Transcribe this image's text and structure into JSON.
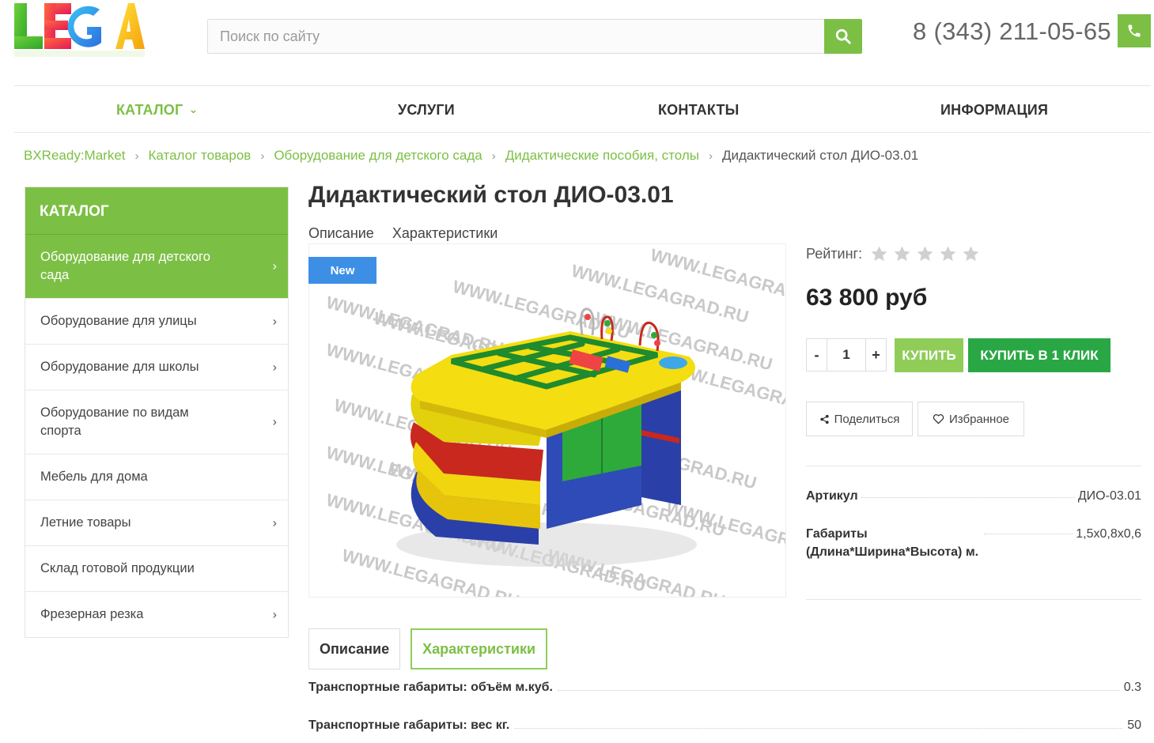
{
  "header": {
    "logo_text": "LEGA",
    "search_placeholder": "Поиск по сайту",
    "phone": "8 (343) 211-05-65"
  },
  "nav": {
    "items": [
      {
        "label": "КАТАЛОГ",
        "chevron": "⌄",
        "active": true
      },
      {
        "label": "УСЛУГИ"
      },
      {
        "label": "КОНТАКТЫ"
      },
      {
        "label": "ИНФОРМАЦИЯ"
      }
    ]
  },
  "breadcrumb": {
    "items": [
      "BXReady:Market",
      "Каталог товаров",
      "Оборудование для детского сада",
      "Дидактические пособия, столы"
    ],
    "current": "Дидактический стол ДИО-03.01",
    "separator": "›"
  },
  "sidebar": {
    "title": "КАТАЛОГ",
    "items": [
      {
        "label": "Оборудование для детского сада",
        "arrow": "›"
      },
      {
        "label": "Оборудование для улицы",
        "arrow": "›"
      },
      {
        "label": "Оборудование для школы",
        "arrow": "›"
      },
      {
        "label": "Оборудование по видам спорта",
        "arrow": "›"
      },
      {
        "label": "Мебель для дома",
        "arrow": ""
      },
      {
        "label": "Летние товары",
        "arrow": "›"
      },
      {
        "label": "Склад готовой продукции",
        "arrow": ""
      },
      {
        "label": "Фрезерная резка",
        "arrow": "›"
      }
    ]
  },
  "product": {
    "title": "Дидактический стол ДИО-03.01",
    "subtabs": [
      "Описание",
      "Характеристики"
    ],
    "badge": "New",
    "watermark": "WWW.LEGAGRAD.RU",
    "rating_label": "Рейтинг:",
    "rating_value": 0,
    "rating_max": 5,
    "price": "63 800 руб",
    "qty": {
      "minus": "-",
      "value": "1",
      "plus": "+"
    },
    "buy_label": "КУПИТЬ",
    "buy_one_click_label": "КУПИТЬ В 1 КЛИК",
    "share_label": "Поделиться",
    "favorite_label": "Избранное",
    "props": [
      {
        "name": "Артикул",
        "value": "ДИО-03.01"
      },
      {
        "name": "Габариты (Длина*Ширина*Высота) м.",
        "value": "1,5х0,8х0,6"
      }
    ]
  },
  "tabs": {
    "items": [
      "Описание",
      "Характеристики"
    ],
    "selected": 1
  },
  "specs": [
    {
      "name": "Транспортные габариты: объём м.куб.",
      "value": "0.3"
    },
    {
      "name": "Транспортные габариты: вес кг.",
      "value": "50"
    }
  ],
  "colors": {
    "accent": "#7cbf45",
    "buy": "#8fcd58",
    "buy_one_click": "#2aa745",
    "badge": "#3d8fe6"
  }
}
